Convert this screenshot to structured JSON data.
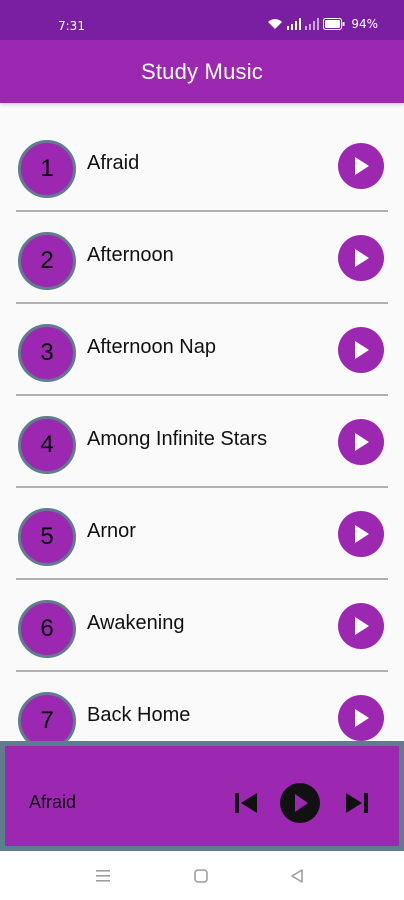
{
  "status_bar": {
    "time": "7:31",
    "battery": "94%",
    "icons": [
      "wifi-icon",
      "signal-icon",
      "signal-icon",
      "battery-icon"
    ]
  },
  "app_bar": {
    "title": "Study Music"
  },
  "tracks": [
    {
      "number": "1",
      "title": "Afraid"
    },
    {
      "number": "2",
      "title": "Afternoon"
    },
    {
      "number": "3",
      "title": "Afternoon Nap"
    },
    {
      "number": "4",
      "title": "Among Infinite Stars"
    },
    {
      "number": "5",
      "title": "Arnor"
    },
    {
      "number": "6",
      "title": "Awakening"
    },
    {
      "number": "7",
      "title": "Back Home"
    }
  ],
  "player": {
    "now_playing": "Afraid",
    "controls": [
      "skip-previous-icon",
      "play-icon",
      "skip-next-icon"
    ]
  },
  "nav_bar": {
    "icons": [
      "menu-icon",
      "home-icon",
      "back-icon"
    ]
  },
  "colors": {
    "status_bar": "#7b1fa2",
    "primary": "#9c27b0",
    "ring": "#5f7d8c",
    "divider": "#b0b0b0"
  }
}
